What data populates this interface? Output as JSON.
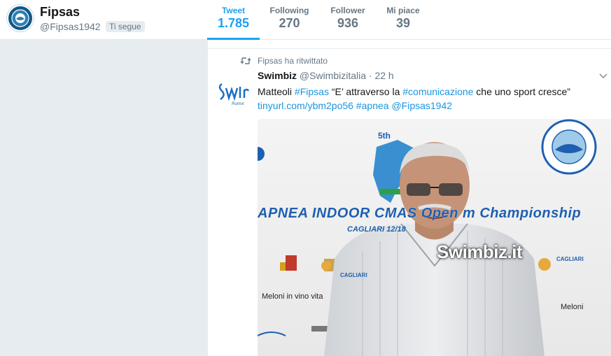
{
  "profile": {
    "name": "Fipsas",
    "handle": "@Fipsas1942",
    "follows_you": "Ti segue",
    "avatar_icon": "fipsas-logo-icon"
  },
  "stats": [
    {
      "label": "Tweet",
      "value": "1.785",
      "active": true
    },
    {
      "label": "Following",
      "value": "270",
      "active": false
    },
    {
      "label": "Follower",
      "value": "936",
      "active": false
    },
    {
      "label": "Mi piace",
      "value": "39",
      "active": false
    }
  ],
  "colors": {
    "accent": "#1da1f2",
    "link": "#1b95e0",
    "muted": "#657786",
    "background": "#e6ecf0"
  },
  "tweet": {
    "retweet_context": "Fipsas ha ritwittato",
    "author_name": "Swimbiz",
    "author_handle": "@Swimbizitalia",
    "time": "· 22 h",
    "text_prefix": "Matteoli ",
    "hashtag_1": "#Fipsas",
    "text_middle": " “E’ attraverso la ",
    "hashtag_2": "#comunicazione",
    "text_suffix": " che uno sport cresce”",
    "url": "tinyurl.com/ybm2po56",
    "hashtag_3": "#apnea",
    "mention": "@Fipsas1942",
    "photo": {
      "watermark": "Swimbiz.it",
      "banner": "APNEA INDOOR CMAS Open       m Championship",
      "banner_sub": "CAGLIARI 12/18",
      "sponsor_1": "Meloni  in vino vita",
      "sponsor_2": "Meloni",
      "sponsor_3": "CAGLIARI",
      "sponsor_4": "CAGLIARI"
    }
  }
}
